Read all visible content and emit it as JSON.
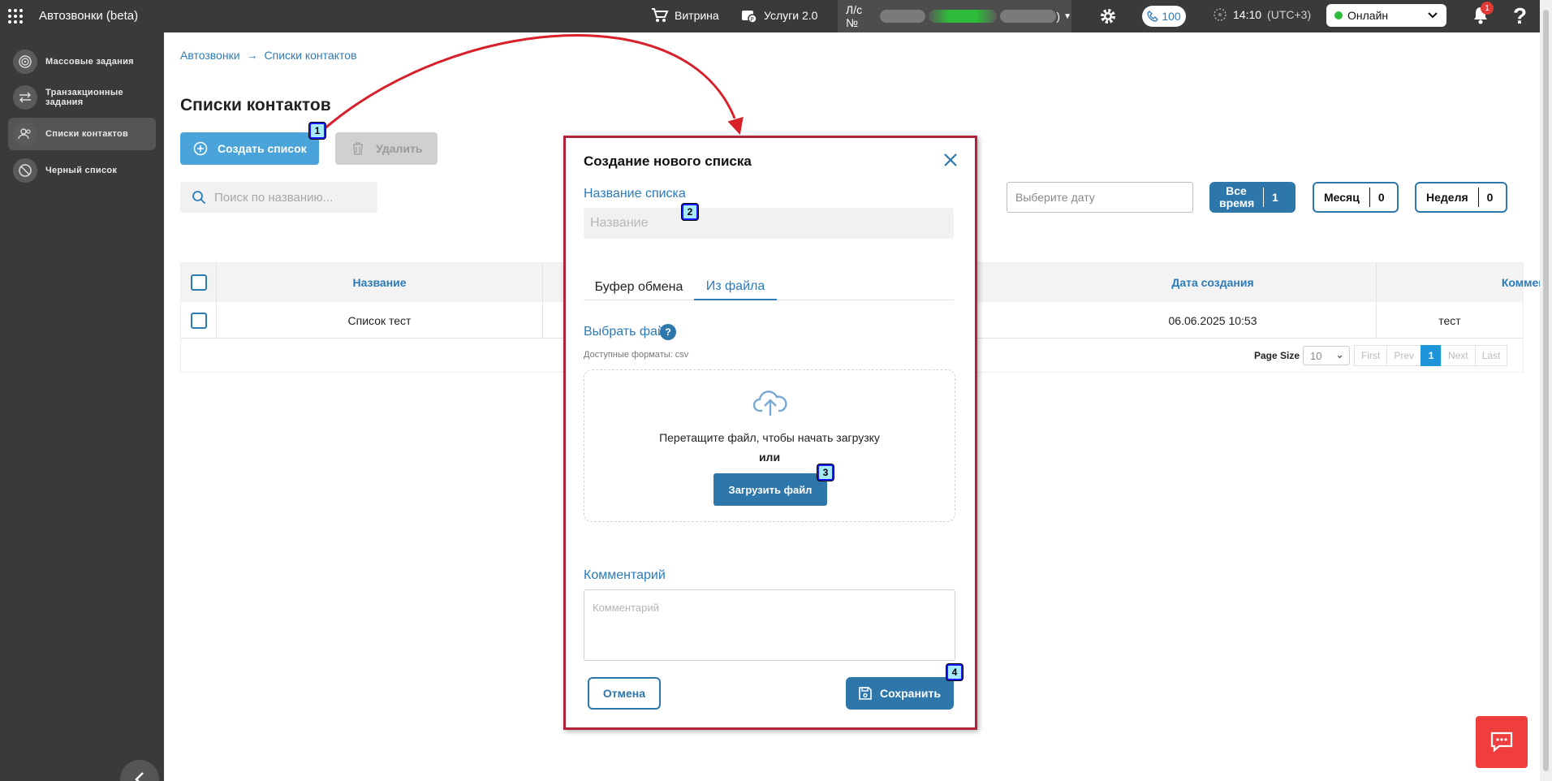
{
  "topbar": {
    "app_title": "Автозвонки (beta)",
    "showcase_label": "Витрина",
    "services_label": "Услуги 2.0",
    "account_prefix": "Л/с №",
    "account_suffix": ")",
    "phone_count": "100",
    "time": "14:10",
    "timezone": "(UTC+3)",
    "status": "Онлайн",
    "notifications_count": "1",
    "help": "?"
  },
  "sidebar": {
    "items": [
      {
        "label": "Массовые задания",
        "icon": "target-icon"
      },
      {
        "label": "Транзакционные задания",
        "icon": "arrows-swap-icon"
      },
      {
        "label": "Списки контактов",
        "icon": "users-icon",
        "active": true
      },
      {
        "label": "Черный список",
        "icon": "ban-icon"
      }
    ]
  },
  "breadcrumb": {
    "root": "Автозвонки",
    "separator": "→",
    "current": "Списки контактов"
  },
  "page": {
    "title": "Списки контактов",
    "create_label": "Создать список",
    "delete_label": "Удалить",
    "search_placeholder": "Поиск по названию...",
    "date_placeholder": "Выберите дату"
  },
  "periods": [
    {
      "label": "Все время",
      "count": "1"
    },
    {
      "label": "Месяц",
      "count": "0"
    },
    {
      "label": "Неделя",
      "count": "0"
    }
  ],
  "table": {
    "columns": [
      "Название",
      "Дата создания",
      "Комментарий"
    ],
    "rows": [
      {
        "name": "Список тест",
        "created": "06.06.2025 10:53",
        "comment": "тест"
      }
    ]
  },
  "pager": {
    "page_size_label": "Page Size",
    "page_size": "10",
    "first": "First",
    "prev": "Prev",
    "current": "1",
    "next": "Next",
    "last": "Last"
  },
  "modal": {
    "title": "Создание нового списка",
    "name_label": "Название списка",
    "name_placeholder": "Название",
    "tabs": [
      "Буфер обмена",
      "Из файла"
    ],
    "active_tab": 1,
    "file_label": "Выбрать файл",
    "help_mark": "?",
    "formats": "Доступные форматы: csv",
    "drop_text": "Перетащите файл, чтобы начать загрузку",
    "or_text": "или",
    "upload_label": "Загрузить файл",
    "comment_label": "Комментарий",
    "comment_placeholder": "Комментарий",
    "cancel_label": "Отмена",
    "save_label": "Сохранить"
  },
  "annotations": [
    "1",
    "2",
    "3",
    "4"
  ],
  "colors": {
    "accent": "#2e77aa",
    "create_button": "#4aa3d9",
    "highlight_frame": "#b0233a",
    "topbar": "#3a3a3a",
    "online": "#2ebd3a",
    "chat": "#f03e3e"
  }
}
